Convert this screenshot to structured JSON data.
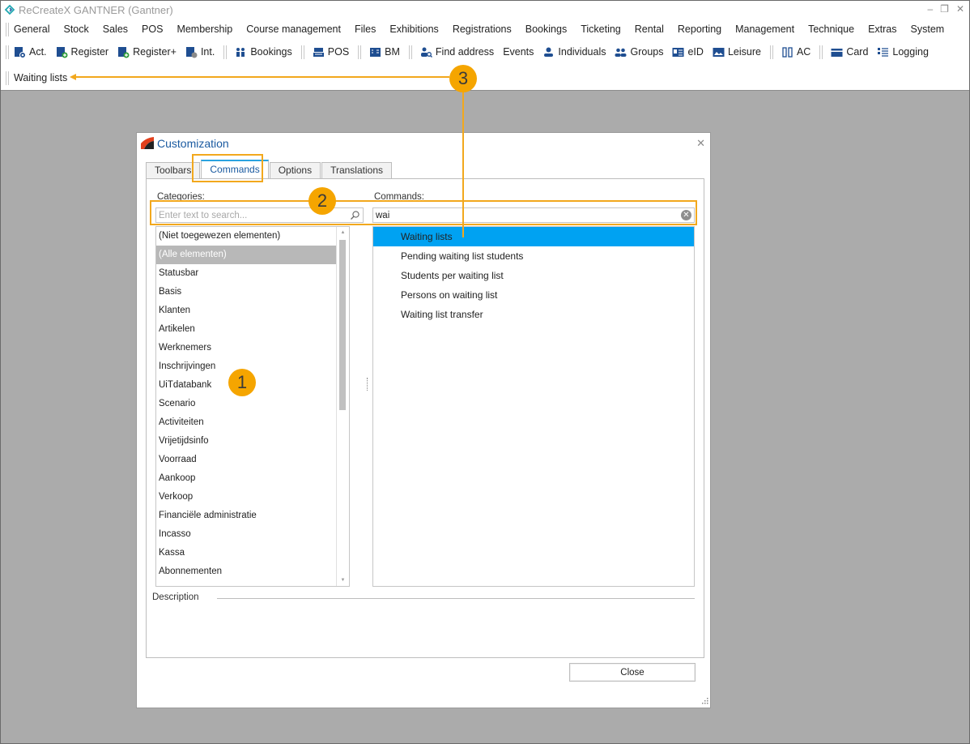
{
  "app": {
    "title": "ReCreateX GANTNER  (Gantner)",
    "window_controls": {
      "minimize": "–",
      "restore": "❐",
      "close": "✕"
    }
  },
  "menubar": {
    "items": [
      "General",
      "Stock",
      "Sales",
      "POS",
      "Membership",
      "Course management",
      "Files",
      "Exhibitions",
      "Registrations",
      "Bookings",
      "Ticketing",
      "Rental",
      "Reporting",
      "Management",
      "Technique",
      "Extras",
      "System"
    ]
  },
  "toolbar": {
    "groups": [
      [
        {
          "label": "Act.",
          "icon": "activity-register-icon"
        },
        {
          "label": "Register",
          "icon": "register-add-icon"
        },
        {
          "label": "Register+",
          "icon": "register-plus-icon"
        },
        {
          "label": "Int.",
          "icon": "internal-register-icon"
        }
      ],
      [
        {
          "label": "Bookings",
          "icon": "bookings-icon"
        }
      ],
      [
        {
          "label": "POS",
          "icon": "pos-register-icon"
        }
      ],
      [
        {
          "label": "BM",
          "icon": "building-management-icon"
        }
      ],
      [
        {
          "label": "Find address",
          "icon": "find-address-icon"
        },
        {
          "label": "Events",
          "icon": ""
        },
        {
          "label": "Individuals",
          "icon": "person-icon"
        },
        {
          "label": "Groups",
          "icon": "group-icon"
        },
        {
          "label": "eID",
          "icon": "id-card-icon"
        },
        {
          "label": "Leisure",
          "icon": "picture-icon"
        }
      ],
      [
        {
          "label": "AC",
          "icon": "access-control-icon"
        }
      ],
      [
        {
          "label": "Card",
          "icon": "card-icon"
        },
        {
          "label": "Logging",
          "icon": "logging-list-icon"
        }
      ]
    ]
  },
  "toolbar2": {
    "items": [
      {
        "label": "Waiting lists"
      }
    ]
  },
  "dialog": {
    "title": "Customization",
    "close_icon": "✕",
    "tabs": [
      {
        "label": "Toolbars",
        "active": false
      },
      {
        "label": "Commands",
        "active": true
      },
      {
        "label": "Options",
        "active": false
      },
      {
        "label": "Translations",
        "active": false
      }
    ],
    "categories": {
      "label": "Categories:",
      "search_placeholder": "Enter text to search...",
      "search_value": "",
      "items": [
        "(Niet toegewezen elementen)",
        "(Alle elementen)",
        "Statusbar",
        "Basis",
        "Klanten",
        "Artikelen",
        "Werknemers",
        "Inschrijvingen",
        "UiTdatabank",
        "Scenario",
        "Activiteiten",
        "Vrijetijdsinfo",
        "Voorraad",
        "Aankoop",
        "Verkoop",
        "Financiële administratie",
        "Incasso",
        "Kassa",
        "Abonnementen"
      ],
      "selected_index": 1
    },
    "commands": {
      "label": "Commands:",
      "search_value": "wai",
      "items": [
        "Waiting lists",
        "Pending waiting list students",
        "Students per waiting list",
        "Persons on waiting list",
        "Waiting list transfer"
      ],
      "selected_index": 0
    },
    "description_label": "Description",
    "close_button": "Close"
  },
  "annotations": {
    "callouts": [
      "1",
      "2",
      "3"
    ],
    "color": "#f5a500"
  }
}
